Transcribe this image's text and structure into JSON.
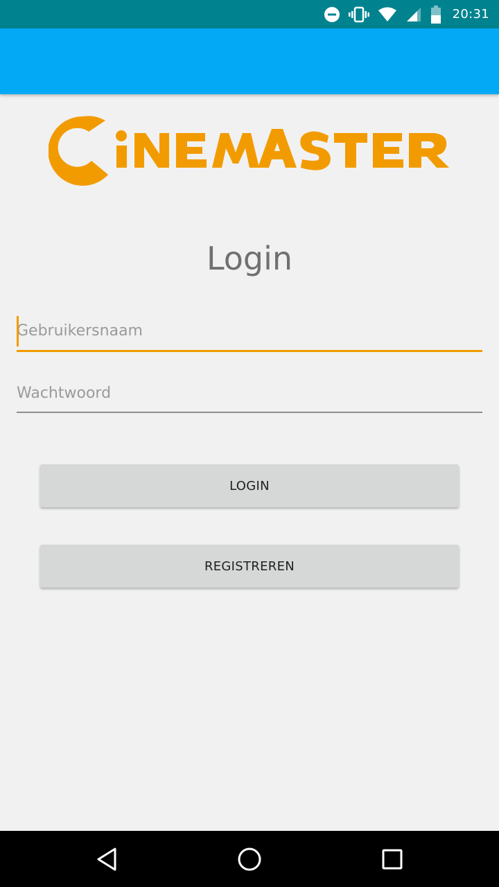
{
  "status_bar": {
    "time": "20:31",
    "icons": [
      "do-not-disturb-icon",
      "vibrate-icon",
      "wifi-icon",
      "cell-signal-icon",
      "battery-icon"
    ]
  },
  "logo": {
    "text": "CINEMASTER",
    "color": "#f29b00"
  },
  "login": {
    "title": "Login",
    "username_placeholder": "Gebruikersnaam",
    "username_value": "",
    "password_placeholder": "Wachtwoord",
    "password_value": "",
    "login_button": "LOGIN",
    "register_button": "REGISTREREN"
  },
  "navigation": {
    "icons": [
      "back-icon",
      "home-icon",
      "recents-icon"
    ]
  },
  "colors": {
    "status_bar": "#00838f",
    "app_bar": "#03a9f4",
    "accent": "#f29b00",
    "background": "#f1f1f1",
    "button": "#d6d7d7"
  }
}
